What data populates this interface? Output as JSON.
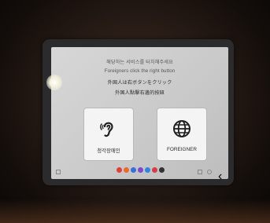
{
  "kiosk": {
    "messages": {
      "korean": "해당하는 서비스를 터치해주세요",
      "english": "Foreigners click the right button",
      "japanese": "外国人は右ボタンをクリック",
      "chinese": "外国人點擊右邊的按鈕"
    },
    "buttons": {
      "left_label": "청각장애인",
      "left_icon": "ear-icon",
      "right_label": "FOREIGNER",
      "right_icon": "globe-icon"
    }
  },
  "taskbar": {
    "apps": [
      {
        "name": "app-red",
        "color": "#e0403a"
      },
      {
        "name": "app-orange",
        "color": "#ea6a2a"
      },
      {
        "name": "app-blue",
        "color": "#3a70d6"
      },
      {
        "name": "app-purple",
        "color": "#7a4ad0"
      },
      {
        "name": "app-blue2",
        "color": "#2f86e0"
      },
      {
        "name": "app-red2",
        "color": "#d83a4a"
      },
      {
        "name": "app-dark",
        "color": "#333333"
      }
    ]
  }
}
